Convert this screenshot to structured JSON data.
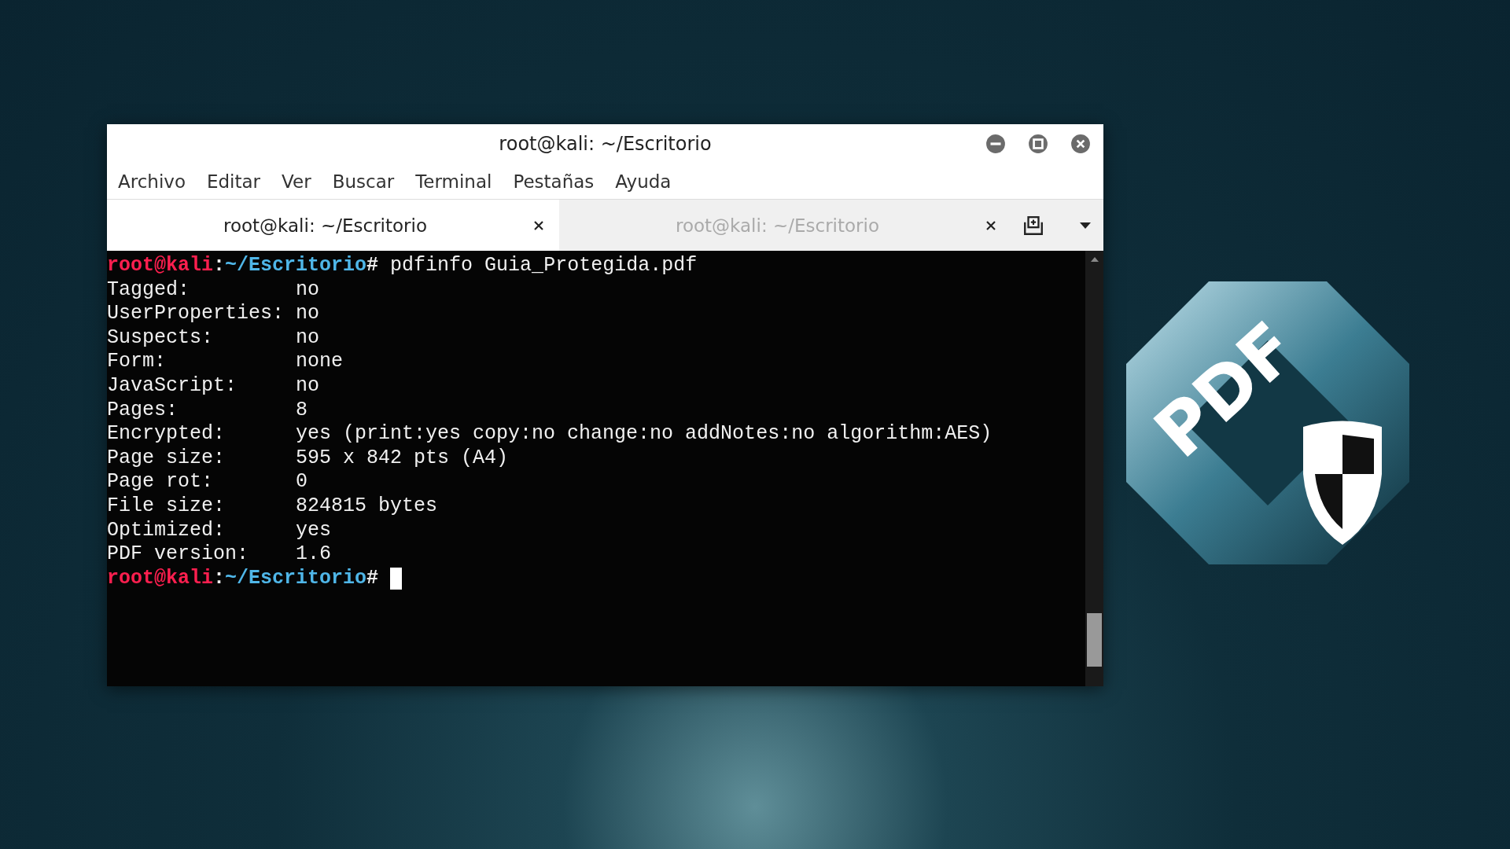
{
  "window": {
    "title": "root@kali: ~/Escritorio"
  },
  "menu": [
    "Archivo",
    "Editar",
    "Ver",
    "Buscar",
    "Terminal",
    "Pestañas",
    "Ayuda"
  ],
  "tabs": [
    {
      "label": "root@kali: ~/Escritorio",
      "selected": true
    },
    {
      "label": "root@kali: ~/Escritorio",
      "selected": false
    }
  ],
  "terminal": {
    "lines": [
      {
        "kind": "prompt",
        "user": "root@kali",
        "separator": ":",
        "path": "~/Escritorio",
        "symbol": "#",
        "command": "pdfinfo Guia_Protegida.pdf"
      },
      {
        "kind": "field",
        "key": "Tagged:",
        "value": "no"
      },
      {
        "kind": "field",
        "key": "UserProperties:",
        "value": "no"
      },
      {
        "kind": "field",
        "key": "Suspects:",
        "value": "no"
      },
      {
        "kind": "field",
        "key": "Form:",
        "value": "none"
      },
      {
        "kind": "field",
        "key": "JavaScript:",
        "value": "no"
      },
      {
        "kind": "field",
        "key": "Pages:",
        "value": "8"
      },
      {
        "kind": "field",
        "key": "Encrypted:",
        "value": "yes (print:yes copy:no change:no addNotes:no algorithm:AES)"
      },
      {
        "kind": "field",
        "key": "Page size:",
        "value": "595 x 842 pts (A4)"
      },
      {
        "kind": "field",
        "key": "Page rot:",
        "value": "0"
      },
      {
        "kind": "field",
        "key": "File size:",
        "value": "824815 bytes"
      },
      {
        "kind": "field",
        "key": "Optimized:",
        "value": "yes"
      },
      {
        "kind": "field",
        "key": "PDF version:",
        "value": "1.6"
      },
      {
        "kind": "prompt",
        "user": "root@kali",
        "separator": ":",
        "path": "~/Escritorio",
        "symbol": "#",
        "cursor": true
      }
    ]
  },
  "logo": {
    "text": "PDF"
  }
}
